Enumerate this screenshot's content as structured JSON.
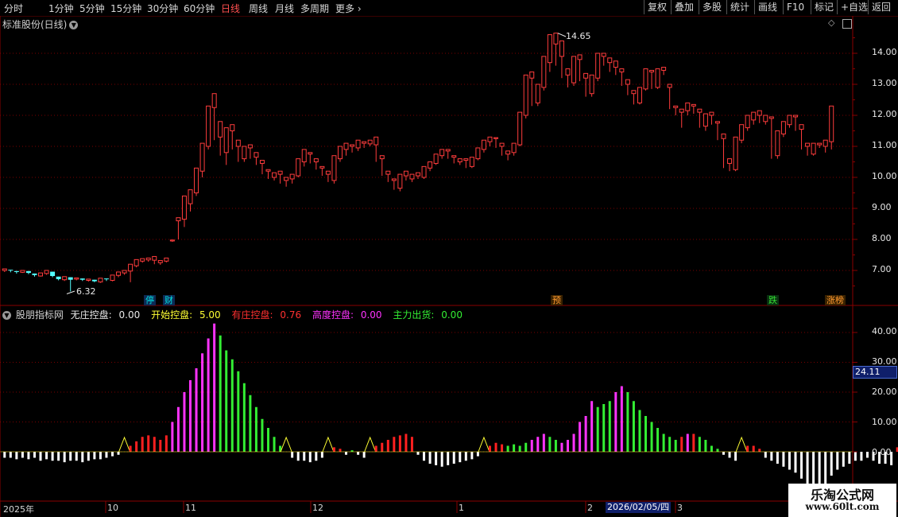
{
  "toolbar": {
    "periods": [
      "分时",
      "1分钟",
      "5分钟",
      "15分钟",
      "30分钟",
      "60分钟",
      "日线",
      "周线",
      "月线",
      "多周期",
      "更多"
    ],
    "active": "日线",
    "right": [
      "复权",
      "叠加",
      "多股",
      "统计",
      "画线",
      "F10",
      "标记",
      "+自选",
      "返回"
    ]
  },
  "stock": {
    "title": "标准股份(日线)",
    "dropdown_icon": "chevron-down-icon"
  },
  "price_axis": {
    "ticks": [
      "14.00",
      "13.00",
      "12.00",
      "11.00",
      "10.00",
      "9.00",
      "8.00",
      "7.00"
    ],
    "min": 6.0,
    "max": 15.0
  },
  "annotations": {
    "high": "14.65",
    "low": "6.32"
  },
  "signals": [
    {
      "text": "停",
      "color": "#00e0e0"
    },
    {
      "text": "财",
      "color": "#00e0e0"
    },
    {
      "text": "预",
      "color": "#ff9a30"
    },
    {
      "text": "跌",
      "color": "#33dd33"
    },
    {
      "text": "涨榜",
      "color": "#ff9a30"
    }
  ],
  "indicator": {
    "name": "股朋指标网",
    "items": [
      {
        "label": "无庄控盘:",
        "value": "0.00",
        "color": "#e8e8e8"
      },
      {
        "label": "开始控盘:",
        "value": "5.00",
        "color": "#ffff33"
      },
      {
        "label": "有庄控盘:",
        "value": "0.76",
        "color": "#ff3030"
      },
      {
        "label": "高度控盘:",
        "value": "0.00",
        "color": "#ff33ff"
      },
      {
        "label": "主力出货:",
        "value": "0.00",
        "color": "#33ee33"
      }
    ],
    "axis_ticks": [
      "40.00",
      "30.00",
      "20.00",
      "10.00",
      "0.00"
    ],
    "current_value": "24.11",
    "min": -15.0,
    "max": 48.0
  },
  "time_axis": {
    "labels": [
      "2025年",
      "10",
      "11",
      "12",
      "1",
      "2",
      "3"
    ],
    "cursor_date": "2026/02/05/四"
  },
  "watermark": {
    "name": "乐淘公式网",
    "url": "www.60lt.com"
  },
  "colors": {
    "up": "#ff3c3c",
    "down": "#54ffff",
    "grid": "#7a0000",
    "axis": "#8a0000"
  },
  "chart_data": {
    "type": "candlestick",
    "candles": [
      [
        7.0,
        7.05,
        6.95,
        7.02
      ],
      [
        7.02,
        7.0,
        6.94,
        6.98
      ],
      [
        6.98,
        6.95,
        6.9,
        6.94
      ],
      [
        6.94,
        7.0,
        6.92,
        6.98
      ],
      [
        6.98,
        6.92,
        6.88,
        6.9
      ],
      [
        6.9,
        6.85,
        6.8,
        6.82
      ],
      [
        6.82,
        6.92,
        6.8,
        6.9
      ],
      [
        6.9,
        7.0,
        6.86,
        6.96
      ],
      [
        6.96,
        6.82,
        6.78,
        6.8
      ],
      [
        6.8,
        6.72,
        6.68,
        6.7
      ],
      [
        6.7,
        6.8,
        6.66,
        6.78
      ],
      [
        6.78,
        6.7,
        6.32,
        6.72
      ],
      [
        6.72,
        6.76,
        6.68,
        6.74
      ],
      [
        6.74,
        6.7,
        6.66,
        6.68
      ],
      [
        6.68,
        6.72,
        6.64,
        6.7
      ],
      [
        6.7,
        6.65,
        6.62,
        6.63
      ],
      [
        6.63,
        6.75,
        6.6,
        6.74
      ],
      [
        6.74,
        6.72,
        6.66,
        6.68
      ],
      [
        6.68,
        6.85,
        6.65,
        6.84
      ],
      [
        6.84,
        6.95,
        6.78,
        6.92
      ],
      [
        6.92,
        7.0,
        6.86,
        6.98
      ],
      [
        6.98,
        7.2,
        6.62,
        7.15
      ],
      [
        7.15,
        7.35,
        7.1,
        7.3
      ],
      [
        7.3,
        7.38,
        7.25,
        7.34
      ],
      [
        7.34,
        7.4,
        7.28,
        7.33
      ],
      [
        7.33,
        7.45,
        7.2,
        7.25
      ],
      [
        7.25,
        7.32,
        7.18,
        7.3
      ],
      [
        7.3,
        7.4,
        7.26,
        7.38
      ],
      [
        7.95,
        7.98,
        7.92,
        7.95
      ],
      [
        8.6,
        8.7,
        8.0,
        8.65
      ],
      [
        8.65,
        9.4,
        8.4,
        9.15
      ],
      [
        9.15,
        9.6,
        8.9,
        9.5
      ],
      [
        9.5,
        10.3,
        9.4,
        10.2
      ],
      [
        10.2,
        11.1,
        10.0,
        11.0
      ],
      [
        11.0,
        12.3,
        10.9,
        12.25
      ],
      [
        12.25,
        12.7,
        11.2,
        11.3
      ],
      [
        11.3,
        11.8,
        10.7,
        10.8
      ],
      [
        10.8,
        11.6,
        10.4,
        11.5
      ],
      [
        11.5,
        11.7,
        10.9,
        11.0
      ],
      [
        11.0,
        11.2,
        10.5,
        10.6
      ],
      [
        10.6,
        11.0,
        10.5,
        10.95
      ],
      [
        10.95,
        11.05,
        10.6,
        10.65
      ],
      [
        10.65,
        10.8,
        10.4,
        10.45
      ],
      [
        10.45,
        10.55,
        10.1,
        10.2
      ],
      [
        10.2,
        10.25,
        9.95,
        10.0
      ],
      [
        10.0,
        10.15,
        9.9,
        10.1
      ],
      [
        10.1,
        10.2,
        9.8,
        9.9
      ],
      [
        9.9,
        10.0,
        9.7,
        9.95
      ],
      [
        9.95,
        10.1,
        9.8,
        10.05
      ],
      [
        10.05,
        10.6,
        10.0,
        10.5
      ],
      [
        10.5,
        10.9,
        10.35,
        10.75
      ],
      [
        10.75,
        10.8,
        10.45,
        10.5
      ],
      [
        10.5,
        10.6,
        10.25,
        10.3
      ],
      [
        10.3,
        10.35,
        10.05,
        10.1
      ],
      [
        10.1,
        10.2,
        9.85,
        9.9
      ],
      [
        9.9,
        10.7,
        9.8,
        10.6
      ],
      [
        10.6,
        11.0,
        10.5,
        10.9
      ],
      [
        10.9,
        11.1,
        10.7,
        11.0
      ],
      [
        11.0,
        11.05,
        10.8,
        10.95
      ],
      [
        10.95,
        11.2,
        10.85,
        11.1
      ],
      [
        11.1,
        11.15,
        10.95,
        11.08
      ],
      [
        11.08,
        11.2,
        11.0,
        11.05
      ],
      [
        11.05,
        11.3,
        10.5,
        10.6
      ],
      [
        10.6,
        10.7,
        10.05,
        10.1
      ],
      [
        10.1,
        10.2,
        9.85,
        9.9
      ],
      [
        9.9,
        9.95,
        9.6,
        9.65
      ],
      [
        9.65,
        10.1,
        9.55,
        10.05
      ],
      [
        10.05,
        10.2,
        9.9,
        9.95
      ],
      [
        9.95,
        10.1,
        9.85,
        10.05
      ],
      [
        10.05,
        10.15,
        9.95,
        10.0
      ],
      [
        10.0,
        10.35,
        9.95,
        10.3
      ],
      [
        10.3,
        10.5,
        10.2,
        10.45
      ],
      [
        10.45,
        10.75,
        10.4,
        10.7
      ],
      [
        10.7,
        10.9,
        10.6,
        10.85
      ],
      [
        10.85,
        10.9,
        10.6,
        10.65
      ],
      [
        10.65,
        10.7,
        10.45,
        10.5
      ],
      [
        10.5,
        10.6,
        10.4,
        10.55
      ],
      [
        10.55,
        10.6,
        10.3,
        10.35
      ],
      [
        10.35,
        10.65,
        10.3,
        10.6
      ],
      [
        10.6,
        10.95,
        10.55,
        10.9
      ],
      [
        10.9,
        11.2,
        10.8,
        11.15
      ],
      [
        11.15,
        11.3,
        11.0,
        11.25
      ],
      [
        11.25,
        11.28,
        10.95,
        11.0
      ],
      [
        11.0,
        11.1,
        10.7,
        10.75
      ],
      [
        10.75,
        10.85,
        10.55,
        10.8
      ],
      [
        10.8,
        11.1,
        10.7,
        11.05
      ],
      [
        11.05,
        12.1,
        11.0,
        12.0
      ],
      [
        12.0,
        13.3,
        11.9,
        13.2
      ],
      [
        13.2,
        13.4,
        12.3,
        12.4
      ],
      [
        12.4,
        13.0,
        12.3,
        12.9
      ],
      [
        12.9,
        13.9,
        12.8,
        13.7
      ],
      [
        13.7,
        14.6,
        13.4,
        14.3
      ],
      [
        14.3,
        14.65,
        13.6,
        13.9
      ],
      [
        13.9,
        14.4,
        13.2,
        13.3
      ],
      [
        13.3,
        13.5,
        12.9,
        13.05
      ],
      [
        13.05,
        13.9,
        12.95,
        13.8
      ],
      [
        13.8,
        13.95,
        13.1,
        13.2
      ],
      [
        13.2,
        13.35,
        12.6,
        12.7
      ],
      [
        12.7,
        13.3,
        12.6,
        13.2
      ],
      [
        13.2,
        14.0,
        13.1,
        13.9
      ],
      [
        13.9,
        14.0,
        13.6,
        13.7
      ],
      [
        13.7,
        13.85,
        13.4,
        13.55
      ],
      [
        13.55,
        13.75,
        13.3,
        13.4
      ],
      [
        13.4,
        13.5,
        12.95,
        13.0
      ],
      [
        13.0,
        13.15,
        12.65,
        12.7
      ],
      [
        12.7,
        12.8,
        12.35,
        12.4
      ],
      [
        12.4,
        12.9,
        12.35,
        12.85
      ],
      [
        12.85,
        13.5,
        12.8,
        13.4
      ],
      [
        13.4,
        13.45,
        12.85,
        12.9
      ],
      [
        12.9,
        13.5,
        12.85,
        13.45
      ],
      [
        13.45,
        13.55,
        13.3,
        13.35
      ],
      [
        12.9,
        13.0,
        12.2,
        12.25
      ],
      [
        12.25,
        12.3,
        12.0,
        12.1
      ],
      [
        12.1,
        12.2,
        11.6,
        12.15
      ],
      [
        12.15,
        12.4,
        12.0,
        12.3
      ],
      [
        12.3,
        12.35,
        12.05,
        12.1
      ],
      [
        12.1,
        12.2,
        11.6,
        11.65
      ],
      [
        11.65,
        12.05,
        11.5,
        12.0
      ],
      [
        12.0,
        12.1,
        11.7,
        11.75
      ],
      [
        11.75,
        11.8,
        11.2,
        11.25
      ],
      [
        11.25,
        11.4,
        10.3,
        10.45
      ],
      [
        10.45,
        10.6,
        10.2,
        10.25
      ],
      [
        10.25,
        11.3,
        10.2,
        11.2
      ],
      [
        11.2,
        11.7,
        11.1,
        11.6
      ],
      [
        11.6,
        12.0,
        11.5,
        11.85
      ],
      [
        11.85,
        12.1,
        11.7,
        12.0
      ],
      [
        12.0,
        12.15,
        11.75,
        11.8
      ],
      [
        11.8,
        12.0,
        11.7,
        11.9
      ],
      [
        11.9,
        11.95,
        10.6,
        10.7
      ],
      [
        10.7,
        11.5,
        10.6,
        11.4
      ],
      [
        11.4,
        11.8,
        11.3,
        11.7
      ],
      [
        11.7,
        12.0,
        11.6,
        11.95
      ],
      [
        11.95,
        12.0,
        11.5,
        11.55
      ],
      [
        11.55,
        11.7,
        10.9,
        11.0
      ],
      [
        11.0,
        11.1,
        10.7,
        10.75
      ],
      [
        10.75,
        11.1,
        10.7,
        11.05
      ],
      [
        11.05,
        11.1,
        10.95,
        11.0
      ],
      [
        11.0,
        11.2,
        10.8,
        11.15
      ],
      [
        11.15,
        12.3,
        10.9,
        12.25
      ]
    ],
    "indicator_bars": [
      [
        -2,
        "w"
      ],
      [
        -2,
        "w"
      ],
      [
        -2.5,
        "w"
      ],
      [
        -2,
        "w"
      ],
      [
        -2.5,
        "w"
      ],
      [
        -2,
        "w"
      ],
      [
        -3,
        "w"
      ],
      [
        -2.5,
        "w"
      ],
      [
        -3,
        "w"
      ],
      [
        -3,
        "w"
      ],
      [
        -3.5,
        "w"
      ],
      [
        -3,
        "w"
      ],
      [
        -3,
        "w"
      ],
      [
        -3.5,
        "w"
      ],
      [
        -3,
        "w"
      ],
      [
        -2.5,
        "w"
      ],
      [
        -2.5,
        "w"
      ],
      [
        -2,
        "w"
      ],
      [
        -1.5,
        "w"
      ],
      [
        -1,
        "w"
      ],
      [
        0,
        "y"
      ],
      [
        2,
        "r"
      ],
      [
        3.5,
        "r"
      ],
      [
        5,
        "r"
      ],
      [
        5.5,
        "r"
      ],
      [
        5,
        "r"
      ],
      [
        4,
        "r"
      ],
      [
        5.5,
        "r"
      ],
      [
        10,
        "m"
      ],
      [
        15,
        "m"
      ],
      [
        20,
        "m"
      ],
      [
        24,
        "m"
      ],
      [
        28,
        "m"
      ],
      [
        33,
        "m"
      ],
      [
        38,
        "m"
      ],
      [
        43,
        "m"
      ],
      [
        39,
        "g"
      ],
      [
        34,
        "g"
      ],
      [
        31,
        "g"
      ],
      [
        27,
        "g"
      ],
      [
        23,
        "g"
      ],
      [
        19,
        "g"
      ],
      [
        15,
        "g"
      ],
      [
        11,
        "g"
      ],
      [
        8,
        "g"
      ],
      [
        5,
        "g"
      ],
      [
        2,
        "g"
      ],
      [
        0,
        "y"
      ],
      [
        -2,
        "w"
      ],
      [
        -3,
        "w"
      ],
      [
        -3,
        "w"
      ],
      [
        -3.5,
        "w"
      ],
      [
        -3,
        "w"
      ],
      [
        -2,
        "w"
      ],
      [
        0,
        "y"
      ],
      [
        1.5,
        "r"
      ],
      [
        1,
        "r"
      ],
      [
        -1,
        "w"
      ],
      [
        0.5,
        "g"
      ],
      [
        -1,
        "w"
      ],
      [
        -2,
        "w"
      ],
      [
        0,
        "y"
      ],
      [
        2,
        "r"
      ],
      [
        3,
        "r"
      ],
      [
        4,
        "r"
      ],
      [
        5,
        "r"
      ],
      [
        5.5,
        "r"
      ],
      [
        6,
        "r"
      ],
      [
        5,
        "r"
      ],
      [
        -1,
        "w"
      ],
      [
        -3,
        "w"
      ],
      [
        -4,
        "w"
      ],
      [
        -4.5,
        "w"
      ],
      [
        -5,
        "w"
      ],
      [
        -4.5,
        "w"
      ],
      [
        -4,
        "w"
      ],
      [
        -3.5,
        "w"
      ],
      [
        -3,
        "w"
      ],
      [
        -2.5,
        "w"
      ],
      [
        -1.5,
        "w"
      ],
      [
        0,
        "y"
      ],
      [
        2,
        "r"
      ],
      [
        3,
        "r"
      ],
      [
        2.5,
        "r"
      ],
      [
        2,
        "g"
      ],
      [
        2.5,
        "g"
      ],
      [
        2,
        "g"
      ],
      [
        3,
        "g"
      ],
      [
        4,
        "m"
      ],
      [
        5,
        "m"
      ],
      [
        6,
        "m"
      ],
      [
        5,
        "g"
      ],
      [
        4,
        "g"
      ],
      [
        3,
        "m"
      ],
      [
        4,
        "m"
      ],
      [
        6,
        "m"
      ],
      [
        10,
        "m"
      ],
      [
        12,
        "m"
      ],
      [
        17,
        "m"
      ],
      [
        15,
        "g"
      ],
      [
        16,
        "g"
      ],
      [
        17,
        "g"
      ],
      [
        20,
        "m"
      ],
      [
        22,
        "m"
      ],
      [
        20,
        "g"
      ],
      [
        17,
        "g"
      ],
      [
        14,
        "g"
      ],
      [
        12,
        "g"
      ],
      [
        10,
        "g"
      ],
      [
        8,
        "g"
      ],
      [
        6,
        "g"
      ],
      [
        5,
        "g"
      ],
      [
        4,
        "g"
      ],
      [
        5,
        "r"
      ],
      [
        6,
        "m"
      ],
      [
        6,
        "r"
      ],
      [
        5,
        "g"
      ],
      [
        4,
        "g"
      ],
      [
        2,
        "g"
      ],
      [
        1,
        "g"
      ],
      [
        -1,
        "w"
      ],
      [
        -2,
        "w"
      ],
      [
        -3,
        "w"
      ],
      [
        0,
        "y"
      ],
      [
        2,
        "r"
      ],
      [
        2,
        "r"
      ],
      [
        1,
        "r"
      ],
      [
        -2,
        "w"
      ],
      [
        -3,
        "w"
      ],
      [
        -4,
        "w"
      ],
      [
        -5,
        "w"
      ],
      [
        -6,
        "w"
      ],
      [
        -7,
        "w"
      ],
      [
        -9,
        "w"
      ],
      [
        -12,
        "w"
      ],
      [
        -15,
        "w"
      ],
      [
        -14,
        "w"
      ],
      [
        -11,
        "w"
      ],
      [
        -8,
        "w"
      ],
      [
        -6,
        "w"
      ],
      [
        -5,
        "w"
      ],
      [
        -4,
        "w"
      ],
      [
        -3,
        "w"
      ],
      [
        -3,
        "w"
      ],
      [
        -2,
        "w"
      ],
      [
        -3,
        "w"
      ],
      [
        -4,
        "w"
      ],
      [
        -4,
        "w"
      ],
      [
        -4.5,
        "w"
      ],
      [
        1.5,
        "r"
      ]
    ]
  }
}
